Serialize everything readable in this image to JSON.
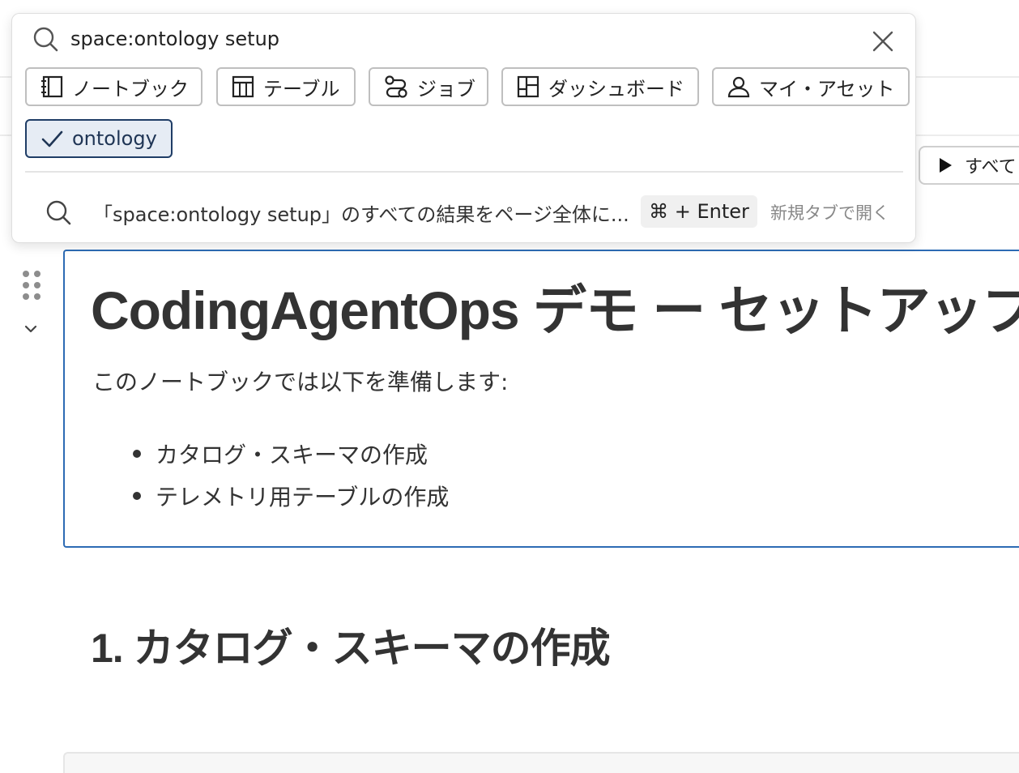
{
  "search": {
    "query": "space:ontology setup",
    "placeholder": "",
    "filters": [
      {
        "label": "ノートブック",
        "icon": "notebook-icon"
      },
      {
        "label": "テーブル",
        "icon": "table-icon"
      },
      {
        "label": "ジョブ",
        "icon": "jobs-icon"
      },
      {
        "label": "ダッシュボード",
        "icon": "dashboard-icon"
      },
      {
        "label": "マイ・アセット",
        "icon": "user-icon"
      }
    ],
    "active_filter": {
      "label": "ontology",
      "icon": "check-icon"
    },
    "result": {
      "text": "「space:ontology setup」のすべての結果をページ全体に...",
      "shortcut": "⌘ + Enter",
      "open_new_tab": "新規タブで開く"
    }
  },
  "toolbar": {
    "run_all_label": "すべて"
  },
  "notebook": {
    "title": "CodingAgentOps デモ ー セットアップ",
    "intro": "このノートブックでは以下を準備します:",
    "bullets": [
      "カタログ・スキーマの作成",
      "テレメトリ用テーブルの作成"
    ],
    "section_heading": "1. カタログ・スキーマの作成"
  },
  "colors": {
    "active_cell_border": "#2d6bb4",
    "active_chip_bg": "#e6ecf4",
    "active_chip_border": "#1f3d66"
  }
}
